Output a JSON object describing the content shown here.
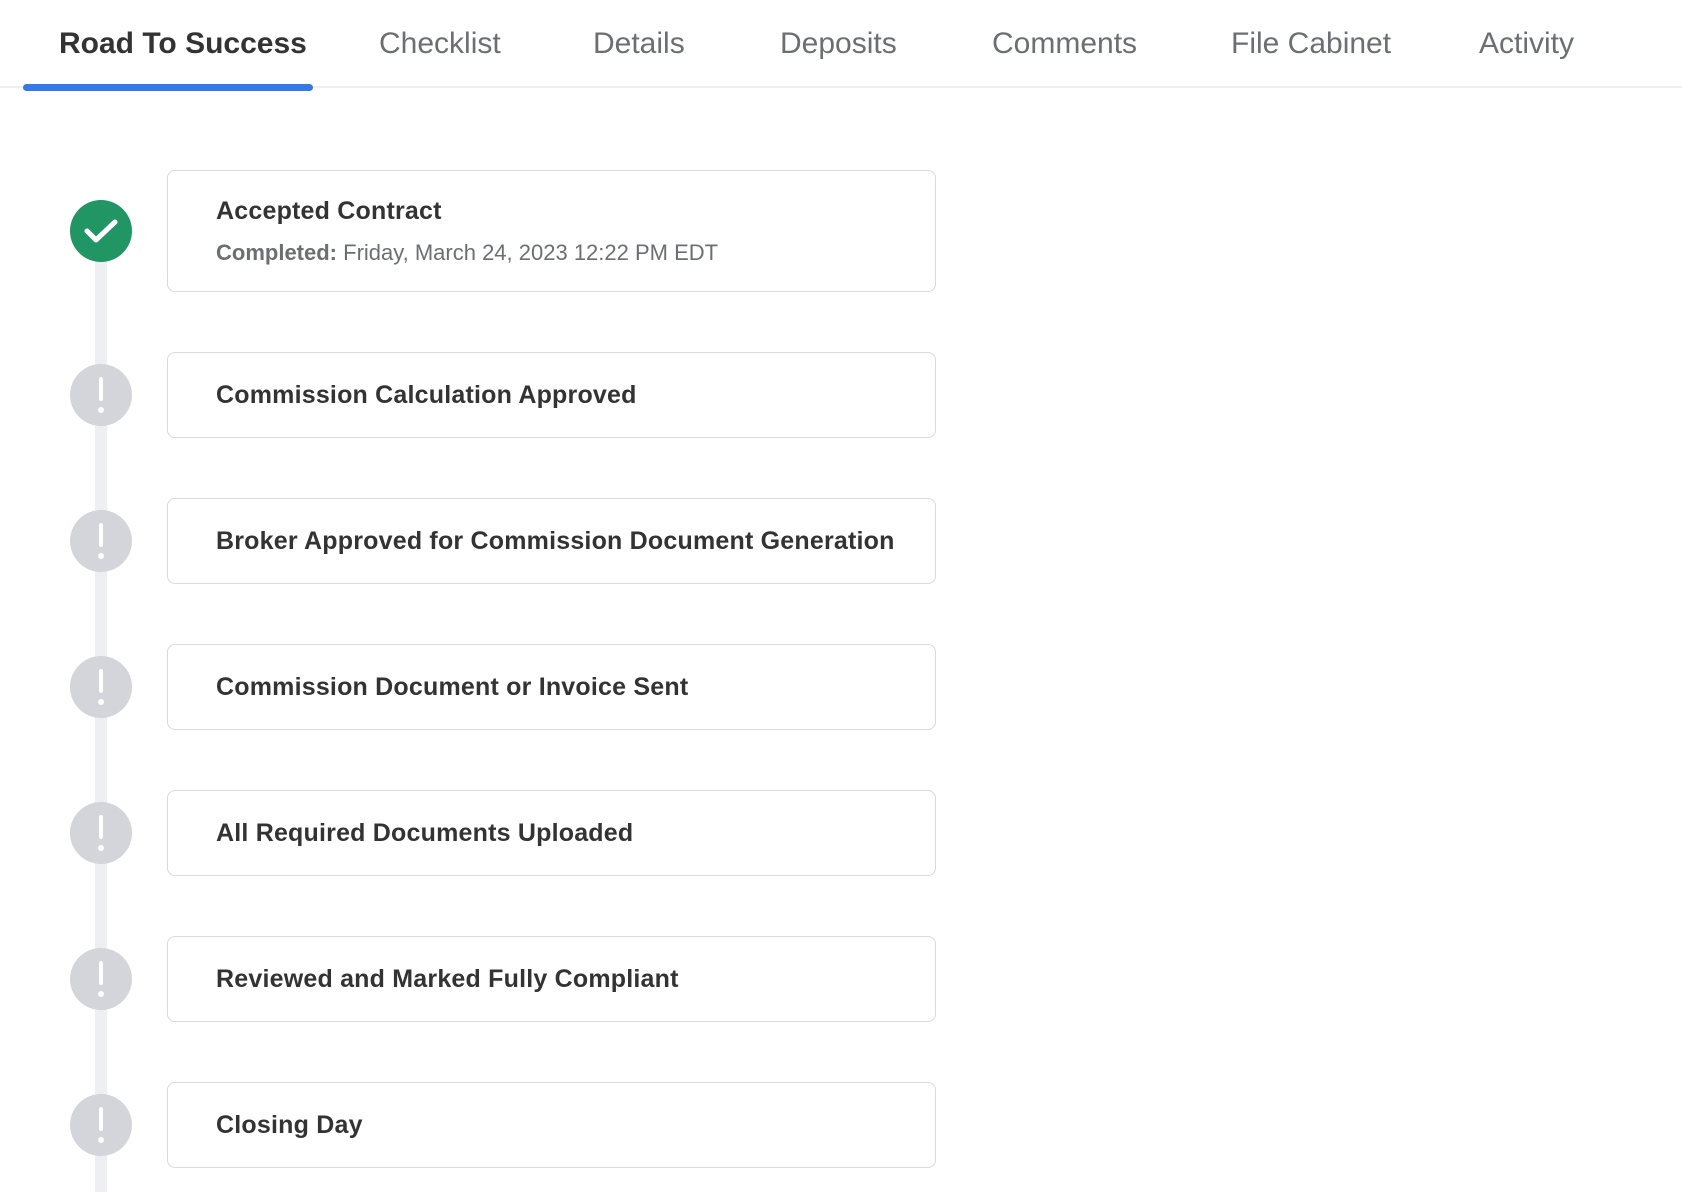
{
  "tabs": [
    {
      "label": "Road To Success",
      "active": true
    },
    {
      "label": "Checklist",
      "active": false
    },
    {
      "label": "Details",
      "active": false
    },
    {
      "label": "Deposits",
      "active": false
    },
    {
      "label": "Comments",
      "active": false
    },
    {
      "label": "File Cabinet",
      "active": false
    },
    {
      "label": "Activity",
      "active": false
    }
  ],
  "steps": [
    {
      "title": "Accepted Contract",
      "status": "completed",
      "icon": "check-icon",
      "completed_label": "Completed:",
      "completed_value": "Friday, March 24, 2023 12:22 PM EDT"
    },
    {
      "title": "Commission Calculation Approved",
      "status": "pending",
      "icon": "exclamation-icon"
    },
    {
      "title": "Broker Approved for Commission Document Generation",
      "status": "pending",
      "icon": "exclamation-icon"
    },
    {
      "title": "Commission Document or Invoice Sent",
      "status": "pending",
      "icon": "exclamation-icon"
    },
    {
      "title": "All Required Documents Uploaded",
      "status": "pending",
      "icon": "exclamation-icon"
    },
    {
      "title": "Reviewed and Marked Fully Compliant",
      "status": "pending",
      "icon": "exclamation-icon"
    },
    {
      "title": "Closing Day",
      "status": "pending",
      "icon": "exclamation-icon"
    }
  ],
  "colors": {
    "accent": "#3479e6",
    "completed": "#219563",
    "pending": "#d3d5da",
    "rail": "#eeeff2"
  }
}
